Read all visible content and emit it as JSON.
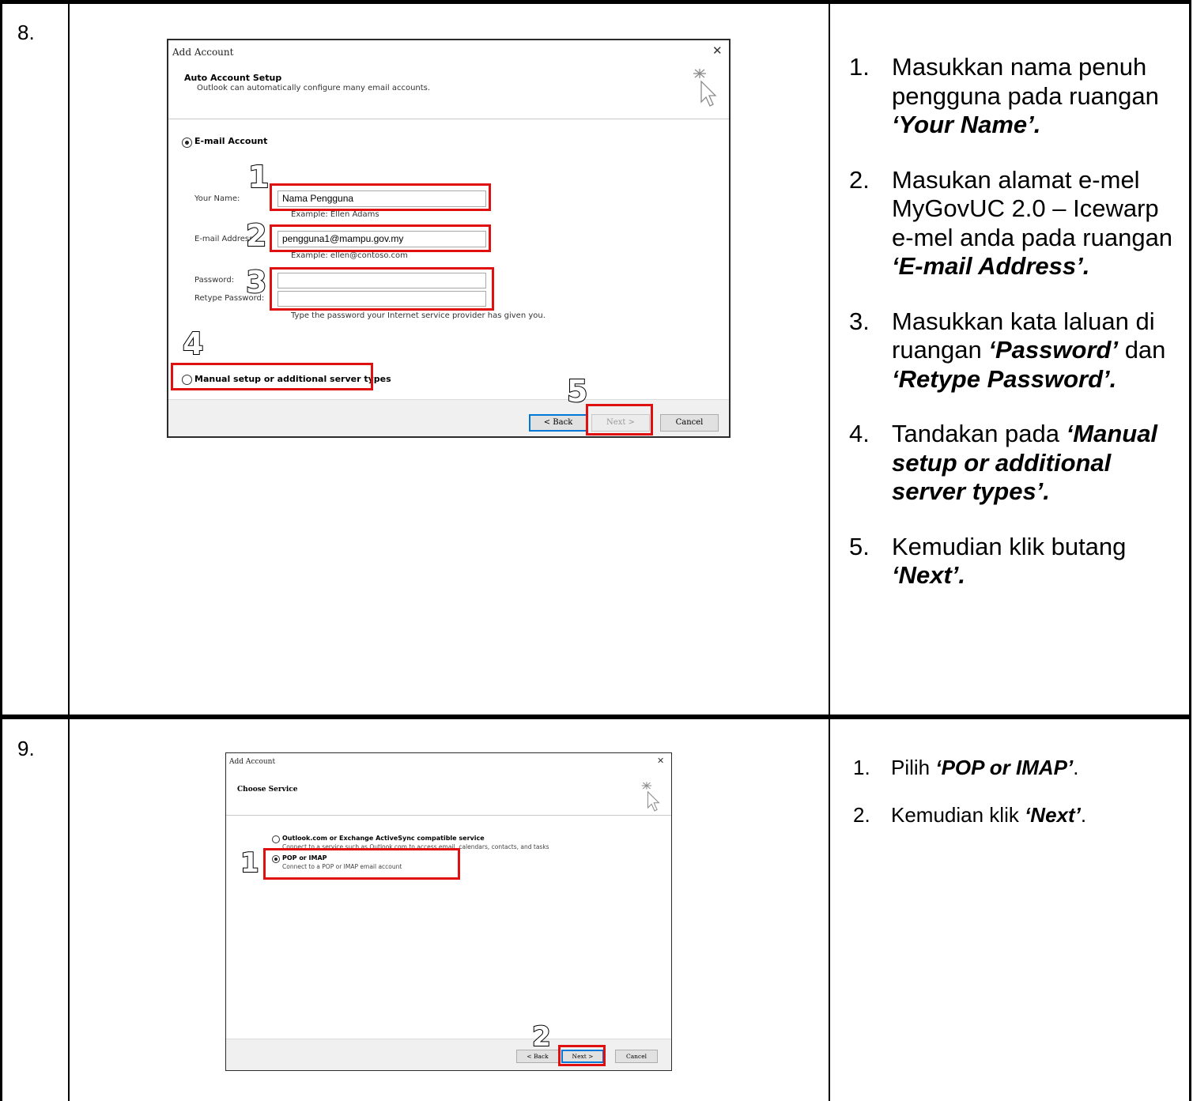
{
  "rows": [
    {
      "number": "8.",
      "dialog": {
        "title": "Add Account",
        "close": "✕",
        "heading": "Auto Account Setup",
        "subheading": "Outlook can automatically configure many email accounts.",
        "email_account_label": "E-mail Account",
        "your_name_label": "Your Name:",
        "your_name_value": "Nama Pengguna",
        "your_name_example": "Example: Ellen Adams",
        "email_label": "E-mail Address:",
        "email_value": "pengguna1@mampu.gov.my",
        "email_example": "Example: ellen@contoso.com",
        "password_label": "Password:",
        "retype_label": "Retype Password:",
        "password_hint": "Type the password your Internet service provider has given you.",
        "manual_label": "Manual setup or additional server types",
        "back_button": "< Back",
        "next_button": "Next >",
        "cancel_button": "Cancel",
        "callouts": [
          "1",
          "2",
          "3",
          "4",
          "5"
        ]
      },
      "instructions": [
        {
          "num": "1.",
          "text": "Masukkan nama penuh pengguna pada ruangan ",
          "emph": "‘Your Name’.",
          "tail": ""
        },
        {
          "num": "2.",
          "text": "Masukan alamat e-mel MyGovUC 2.0 – Icewarp e-mel anda pada ruangan ",
          "emph": "‘E-mail Address’.",
          "tail": ""
        },
        {
          "num": "3.",
          "text": "Masukkan kata laluan di ruangan ",
          "emph": "‘Password’",
          "mid": " dan ",
          "emph2": "‘Retype Password’."
        },
        {
          "num": "4.",
          "text": "Tandakan pada ",
          "emph": "‘Manual setup or additional server types’.",
          "tail": ""
        },
        {
          "num": "5.",
          "text": "Kemudian klik butang ",
          "emph": "‘Next’.",
          "tail": ""
        }
      ]
    },
    {
      "number": "9.",
      "dialog": {
        "title": "Add Account",
        "close": "✕",
        "heading": "Choose Service",
        "option1_label": "Outlook.com or Exchange ActiveSync compatible service",
        "option1_desc": "Connect to a service such as Outlook.com to access email, calendars, contacts, and tasks",
        "option2_label": "POP or IMAP",
        "option2_desc": "Connect to a POP or IMAP email account",
        "back_button": "< Back",
        "next_button": "Next >",
        "cancel_button": "Cancel",
        "callouts": [
          "1",
          "2"
        ]
      },
      "instructions": [
        {
          "num": "1.",
          "text": "Pilih ",
          "emph": "‘POP or IMAP’",
          "tail": "."
        },
        {
          "num": "2.",
          "text": "Kemudian klik ",
          "emph": "‘Next’",
          "tail": "."
        }
      ]
    }
  ]
}
